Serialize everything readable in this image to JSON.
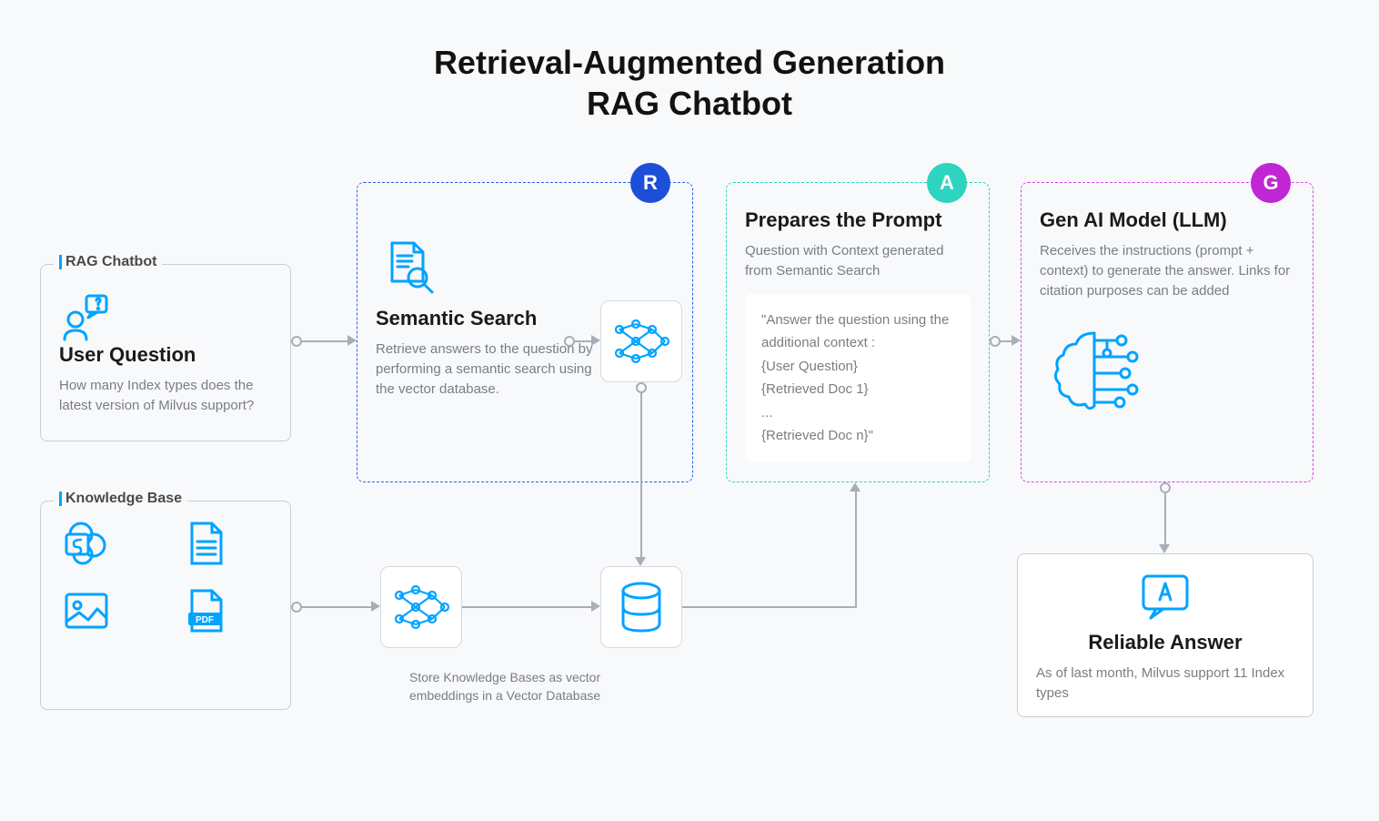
{
  "title_line1": "Retrieval-Augmented Generation",
  "title_line2": "RAG Chatbot",
  "user_box": {
    "label": "RAG Chatbot",
    "title": "User Question",
    "desc": "How many Index types does the latest version of Milvus support?"
  },
  "kb_box": {
    "label": "Knowledge Base"
  },
  "retrieval": {
    "badge": "R",
    "title": "Semantic Search",
    "desc": "Retrieve answers to the question by performing a semantic search using the vector database."
  },
  "augment": {
    "badge": "A",
    "title": "Prepares the Prompt",
    "desc": "Question with Context generated from Semantic Search",
    "prompt_line1": "\"Answer the question using the additional context :",
    "prompt_line2": "{User Question}",
    "prompt_line3": "{Retrieved Doc 1}",
    "prompt_line4": "...",
    "prompt_line5": "{Retrieved Doc n}\""
  },
  "generate": {
    "badge": "G",
    "title": "Gen AI Model (LLM)",
    "desc": "Receives the instructions (prompt + context) to generate the answer. Links for citation purposes can be added"
  },
  "answer": {
    "title": "Reliable Answer",
    "desc": "As of last month, Milvus support 11 Index types"
  },
  "embed_desc": "Store Knowledge Bases as vector embeddings in a Vector Database"
}
